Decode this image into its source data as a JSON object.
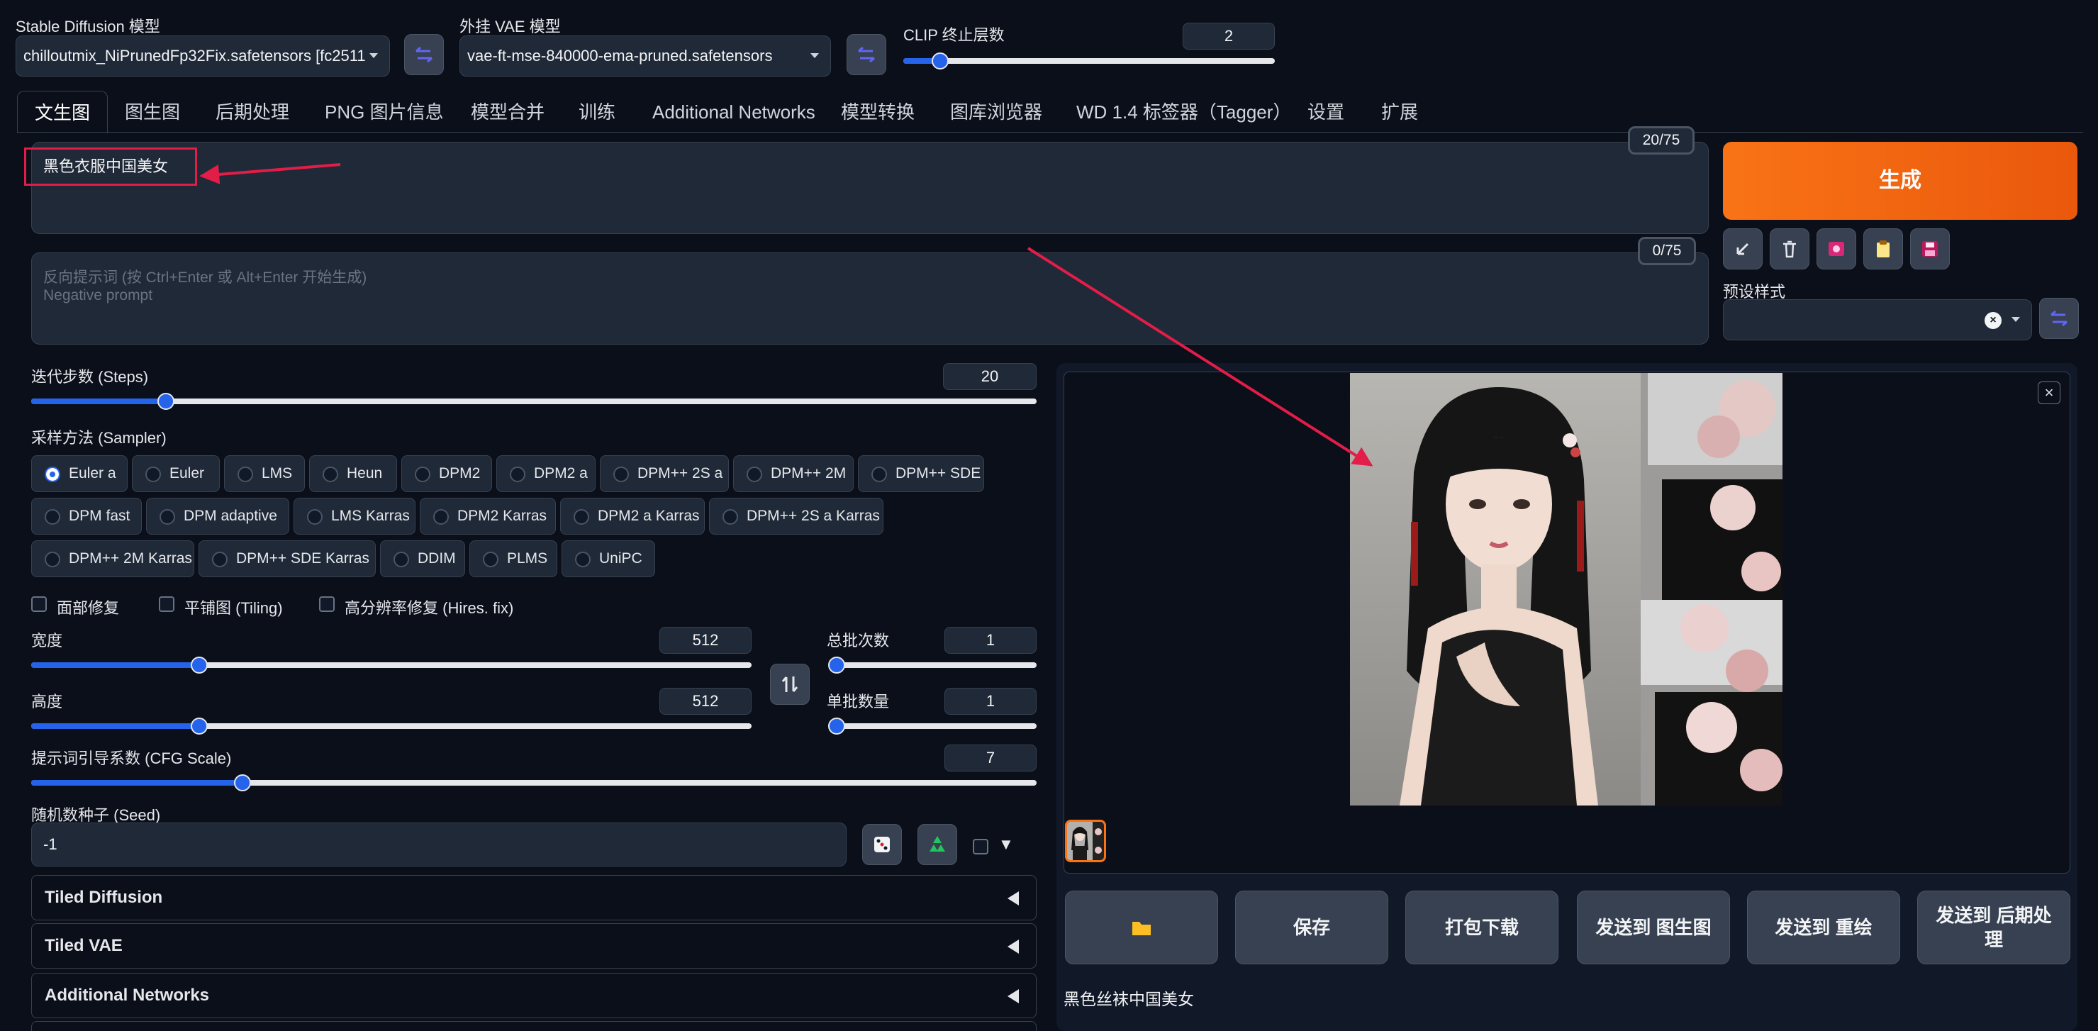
{
  "top": {
    "sd_model_label": "Stable Diffusion 模型",
    "sd_model_value": "chilloutmix_NiPrunedFp32Fix.safetensors [fc2511",
    "vae_label": "外挂 VAE 模型",
    "vae_value": "vae-ft-mse-840000-ema-pruned.safetensors",
    "clip_label": "CLIP 终止层数",
    "clip_value": "2",
    "clip_fraction": 0.1
  },
  "tabs": [
    "文生图",
    "图生图",
    "后期处理",
    "PNG 图片信息",
    "模型合并",
    "训练",
    "Additional Networks",
    "模型转换",
    "图库浏览器",
    "WD 1.4 标签器（Tagger）",
    "设置",
    "扩展"
  ],
  "prompt": {
    "text": "黑色衣服中国美女",
    "counter": "20/75",
    "neg_counter": "0/75",
    "neg_placeholder_line1": "反向提示词 (按 Ctrl+Enter 或 Alt+Enter 开始生成)",
    "neg_placeholder_line2": "Negative prompt"
  },
  "generate": {
    "label": "生成",
    "styles_label": "预设样式",
    "tool_icons": [
      "arrow-diagonal-icon",
      "trash-icon",
      "image-icon",
      "clipboard-icon",
      "floppy-disk-icon"
    ]
  },
  "params": {
    "steps_label": "迭代步数 (Steps)",
    "steps_value": "20",
    "steps_fraction": 0.134,
    "sampler_label": "采样方法 (Sampler)",
    "samplers": [
      "Euler a",
      "Euler",
      "LMS",
      "Heun",
      "DPM2",
      "DPM2 a",
      "DPM++ 2S a",
      "DPM++ 2M",
      "DPM++ SDE",
      "DPM fast",
      "DPM adaptive",
      "LMS Karras",
      "DPM2 Karras",
      "DPM2 a Karras",
      "DPM++ 2S a Karras",
      "DPM++ 2M Karras",
      "DPM++ SDE Karras",
      "DDIM",
      "PLMS",
      "UniPC"
    ],
    "sampler_selected": "Euler a",
    "restore_faces": "面部修复",
    "tiling": "平铺图 (Tiling)",
    "hires": "高分辨率修复 (Hires. fix)",
    "width_label": "宽度",
    "width_value": "512",
    "width_fraction": 0.233,
    "height_label": "高度",
    "height_value": "512",
    "height_fraction": 0.233,
    "batch_count_label": "总批次数",
    "batch_count_value": "1",
    "batch_count_fraction": 0.0,
    "batch_size_label": "单批数量",
    "batch_size_value": "1",
    "batch_size_fraction": 0.0,
    "cfg_label": "提示词引导系数 (CFG Scale)",
    "cfg_value": "7",
    "cfg_fraction": 0.21,
    "seed_label": "随机数种子 (Seed)",
    "seed_value": "-1",
    "extra_arrow": "▼"
  },
  "accordions": [
    "Tiled Diffusion",
    "Tiled VAE",
    "Additional Networks"
  ],
  "output": {
    "buttons": [
      "保存",
      "打包下载",
      "发送到 图生图",
      "发送到 重绘",
      "发送到 后期处理"
    ],
    "caption": "黑色丝袜中国美女"
  },
  "colors": {
    "accent": "#2563eb",
    "generate": "#f97316",
    "annotation": "#e11d48"
  }
}
